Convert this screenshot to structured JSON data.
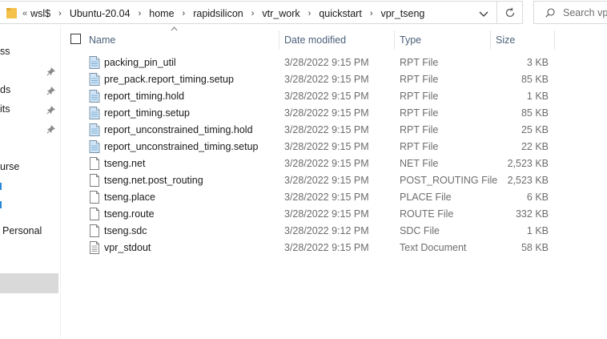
{
  "address_bar": {
    "overflow_marker": "«",
    "breadcrumbs": [
      "wsl$",
      "Ubuntu-20.04",
      "home",
      "rapidsilicon",
      "vtr_work",
      "quickstart",
      "vpr_tseng"
    ],
    "separator": "›",
    "refresh_icon": "refresh-icon",
    "dropdown_icon": "chevron-down-icon"
  },
  "search": {
    "placeholder": "Search vp",
    "icon": "search-icon"
  },
  "nav": {
    "items": [
      {
        "label": "ss",
        "pinned": false
      },
      {
        "label": "",
        "pinned": true
      },
      {
        "label": "ds",
        "pinned": true
      },
      {
        "label": "its",
        "pinned": true
      },
      {
        "label": "",
        "pinned": true
      },
      {
        "label": "urse",
        "pinned": false
      },
      {
        "label": "Personal",
        "pinned": false
      }
    ]
  },
  "columns": {
    "name": "Name",
    "date": "Date modified",
    "type": "Type",
    "size": "Size"
  },
  "files": [
    {
      "name": "packing_pin_util",
      "date": "3/28/2022 9:15 PM",
      "type": "RPT File",
      "size": "3 KB",
      "icon": "rpt-file-icon"
    },
    {
      "name": "pre_pack.report_timing.setup",
      "date": "3/28/2022 9:15 PM",
      "type": "RPT File",
      "size": "85 KB",
      "icon": "rpt-file-icon"
    },
    {
      "name": "report_timing.hold",
      "date": "3/28/2022 9:15 PM",
      "type": "RPT File",
      "size": "1 KB",
      "icon": "rpt-file-icon"
    },
    {
      "name": "report_timing.setup",
      "date": "3/28/2022 9:15 PM",
      "type": "RPT File",
      "size": "85 KB",
      "icon": "rpt-file-icon"
    },
    {
      "name": "report_unconstrained_timing.hold",
      "date": "3/28/2022 9:15 PM",
      "type": "RPT File",
      "size": "25 KB",
      "icon": "rpt-file-icon"
    },
    {
      "name": "report_unconstrained_timing.setup",
      "date": "3/28/2022 9:15 PM",
      "type": "RPT File",
      "size": "22 KB",
      "icon": "rpt-file-icon"
    },
    {
      "name": "tseng.net",
      "date": "3/28/2022 9:15 PM",
      "type": "NET File",
      "size": "2,523 KB",
      "icon": "file-icon"
    },
    {
      "name": "tseng.net.post_routing",
      "date": "3/28/2022 9:15 PM",
      "type": "POST_ROUTING File",
      "size": "2,523 KB",
      "icon": "file-icon"
    },
    {
      "name": "tseng.place",
      "date": "3/28/2022 9:15 PM",
      "type": "PLACE File",
      "size": "6 KB",
      "icon": "file-icon"
    },
    {
      "name": "tseng.route",
      "date": "3/28/2022 9:15 PM",
      "type": "ROUTE File",
      "size": "332 KB",
      "icon": "file-icon"
    },
    {
      "name": "tseng.sdc",
      "date": "3/28/2022 9:12 PM",
      "type": "SDC File",
      "size": "1 KB",
      "icon": "file-icon"
    },
    {
      "name": "vpr_stdout",
      "date": "3/28/2022 9:15 PM",
      "type": "Text Document",
      "size": "58 KB",
      "icon": "text-document-icon"
    }
  ],
  "colors": {
    "folder": "#f4c24a",
    "header_text": "#4c607a",
    "secondary_text": "#6d6d6d",
    "nav_accent": "#2b87d8",
    "selection": "#d9d9d9"
  }
}
